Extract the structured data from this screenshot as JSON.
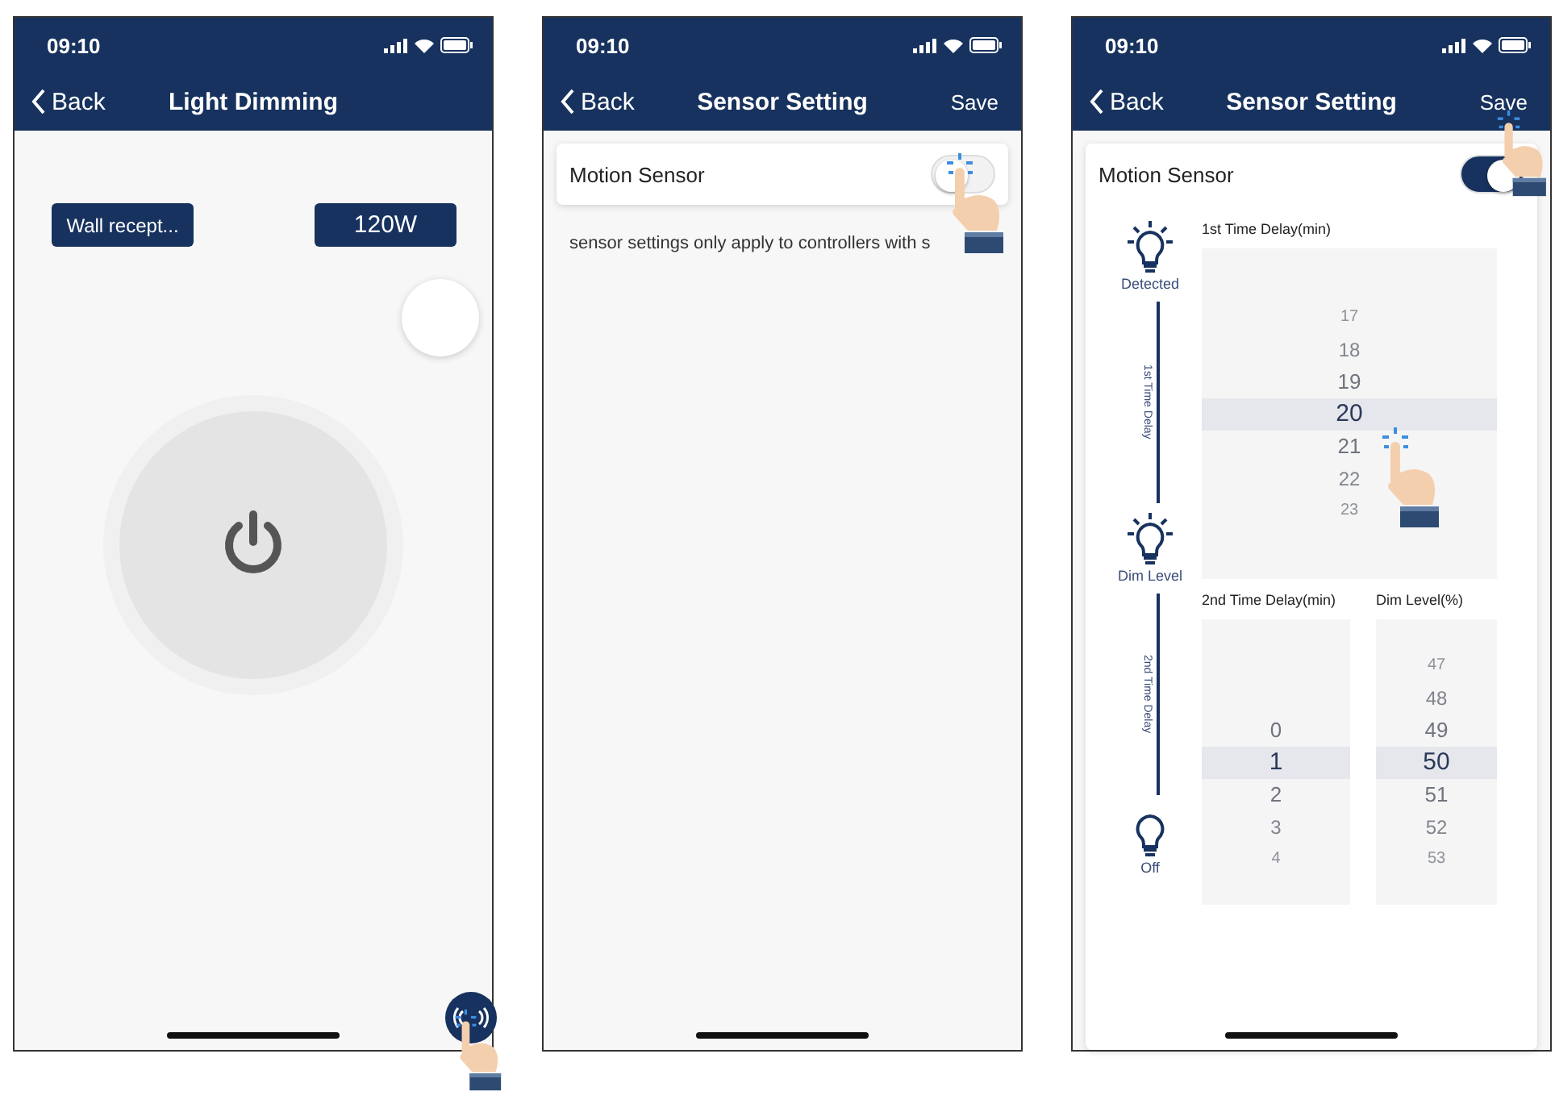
{
  "screens": [
    {
      "kind": "dimming",
      "status_bar": {
        "time": "09:10"
      },
      "nav": {
        "back": "Back",
        "title": "Light Dimming"
      },
      "device_button": "Wall recept...",
      "wattage_button": "120W"
    },
    {
      "kind": "sensor_intro",
      "status_bar": {
        "time": "09:10"
      },
      "nav": {
        "back": "Back",
        "title": "Sensor Setting",
        "action": "Save"
      },
      "motion_sensor": {
        "label": "Motion Sensor",
        "on": false
      },
      "note": "sensor settings only apply to controllers with s"
    },
    {
      "kind": "sensor_detail",
      "status_bar": {
        "time": "09:10"
      },
      "nav": {
        "back": "Back",
        "title": "Sensor Setting",
        "action": "Save"
      },
      "motion_sensor": {
        "label": "Motion Sensor",
        "on": true
      },
      "stages": [
        {
          "label": "Detected",
          "lit": true
        },
        {
          "label": "Dim Level",
          "lit": true
        },
        {
          "label": "Off",
          "lit": false
        }
      ],
      "phases": [
        "1st Time Delay",
        "2nd Time Delay"
      ],
      "pickers": [
        {
          "label": "1st Time Delay(min)",
          "items": [
            {
              "value": "17",
              "selected": false
            },
            {
              "value": "18",
              "selected": false
            },
            {
              "value": "19",
              "selected": false
            },
            {
              "value": "20",
              "selected": true
            },
            {
              "value": "21",
              "selected": false
            },
            {
              "value": "22",
              "selected": false
            },
            {
              "value": "23",
              "selected": false
            }
          ]
        },
        {
          "label": "2nd Time Delay(min)",
          "items": [
            {
              "value": "0",
              "selected": false
            },
            {
              "value": "1",
              "selected": true
            },
            {
              "value": "2",
              "selected": false
            },
            {
              "value": "3",
              "selected": false
            },
            {
              "value": "4",
              "selected": false
            }
          ]
        },
        {
          "label": "Dim Level(%)",
          "items": [
            {
              "value": "47",
              "selected": false
            },
            {
              "value": "48",
              "selected": false
            },
            {
              "value": "49",
              "selected": false
            },
            {
              "value": "50",
              "selected": true
            },
            {
              "value": "51",
              "selected": false
            },
            {
              "value": "52",
              "selected": false
            },
            {
              "value": "53",
              "selected": false
            }
          ]
        }
      ]
    }
  ]
}
